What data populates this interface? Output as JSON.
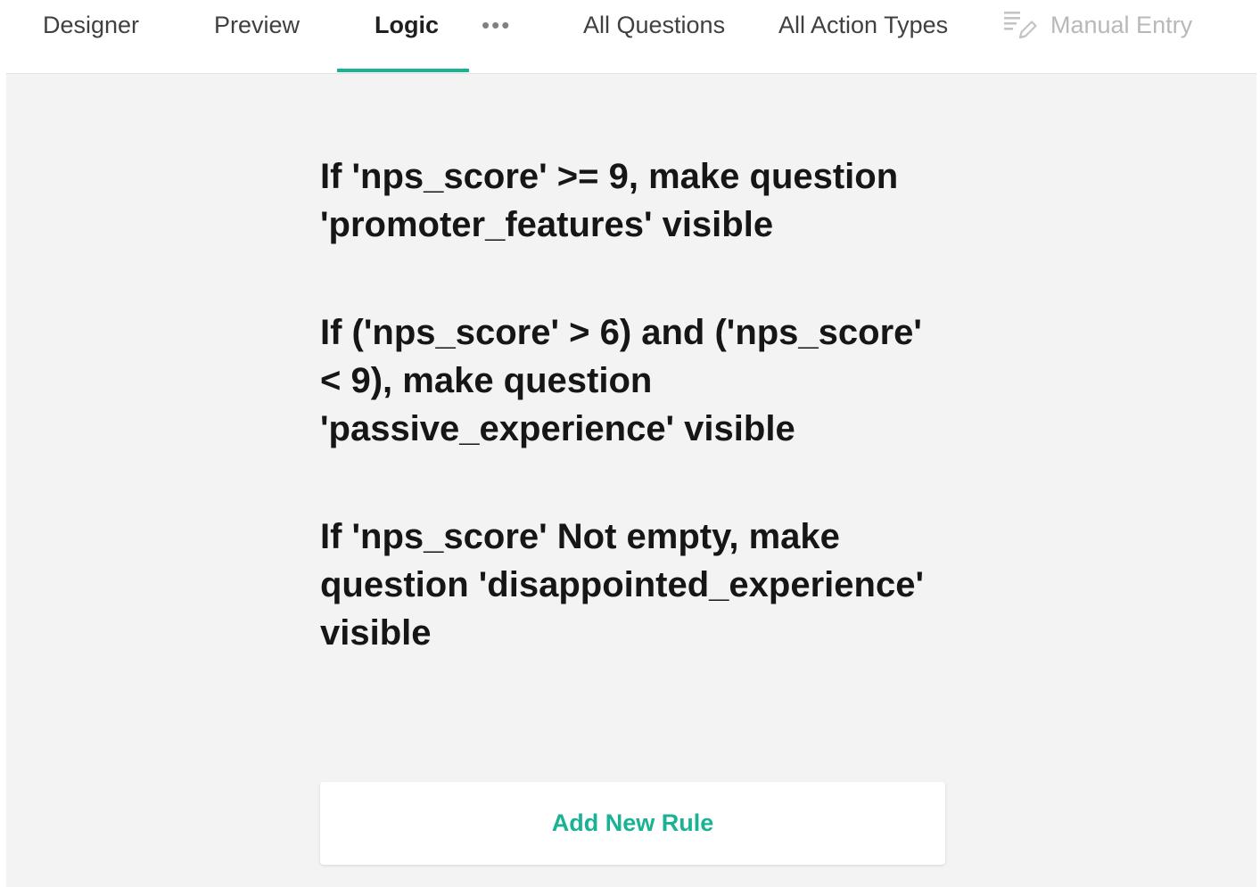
{
  "tabs": {
    "designer": "Designer",
    "preview": "Preview",
    "logic": "Logic",
    "more": "•••"
  },
  "filters": {
    "questions": "All Questions",
    "action_types": "All Action Types",
    "manual_entry": "Manual Entry"
  },
  "rules": [
    {
      "text": "If 'nps_score' >= 9, make question 'promoter_features' visible"
    },
    {
      "text": "If ('nps_score' > 6) and ('nps_score' < 9), make question 'passive_experience' visible"
    },
    {
      "text": "If 'nps_score' Not empty, make question 'disappointed_experience' visible"
    }
  ],
  "add_rule_label": "Add New Rule",
  "colors": {
    "accent": "#19b394",
    "background": "#f3f3f3"
  },
  "icons": {
    "manual_entry": "edit-list-icon",
    "more": "more-dots-icon"
  }
}
